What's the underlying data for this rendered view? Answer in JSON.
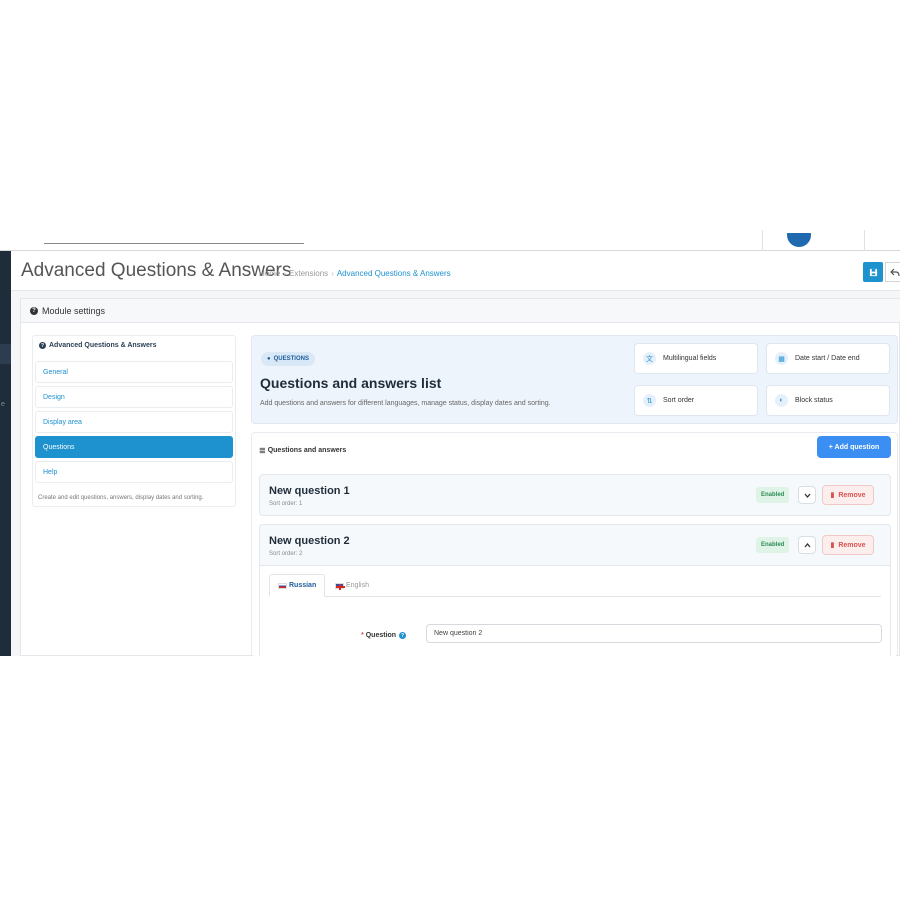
{
  "header": {
    "title": "Advanced Questions & Answers",
    "breadcrumbs": [
      "Home",
      "Extensions",
      "Advanced Questions & Answers"
    ]
  },
  "panel": {
    "heading": "Module settings"
  },
  "sidebar": {
    "title": "Advanced Questions & Answers",
    "items": [
      {
        "label": "General"
      },
      {
        "label": "Design"
      },
      {
        "label": "Display area"
      },
      {
        "label": "Questions",
        "active": true
      },
      {
        "label": "Help"
      }
    ],
    "note": "Create and edit questions, answers, display dates and sorting."
  },
  "hero": {
    "badge": "QUESTIONS",
    "title": "Questions and answers list",
    "description": "Add questions and answers for different languages, manage status, display dates and sorting.",
    "features": [
      {
        "label": "Multilingual fields",
        "icon": "language-icon"
      },
      {
        "label": "Date start / Date end",
        "icon": "calendar-icon"
      },
      {
        "label": "Sort order",
        "icon": "sort-icon"
      },
      {
        "label": "Block status",
        "icon": "toggle-icon"
      }
    ]
  },
  "list": {
    "title": "Questions and answers",
    "add_label": "+ Add question",
    "questions": [
      {
        "title": "New question 1",
        "sort": "Sort order: 1",
        "status": "Enabled",
        "remove": "Remove",
        "expanded": false
      },
      {
        "title": "New question 2",
        "sort": "Sort order: 2",
        "status": "Enabled",
        "remove": "Remove",
        "expanded": true
      }
    ]
  },
  "editor": {
    "tabs": [
      "Russian",
      "English"
    ],
    "question_label": "Question",
    "question_value": "New question 2"
  },
  "colors": {
    "accent": "#1e91cf",
    "add_button": "#3b8ff3",
    "success": "#2e8b57",
    "danger": "#d9534f"
  }
}
